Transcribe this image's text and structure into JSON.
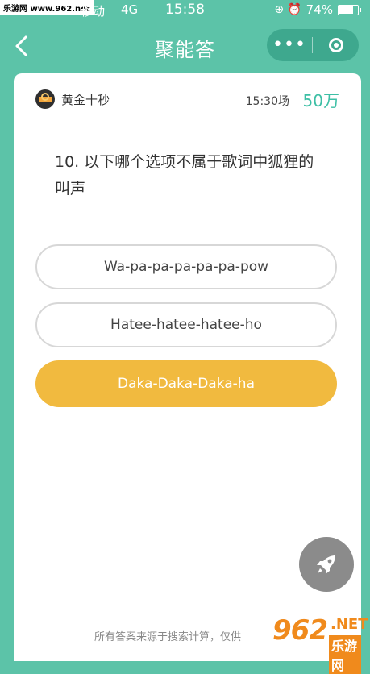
{
  "status_bar": {
    "carrier": "移动",
    "network": "4G",
    "time": "15:58",
    "battery": "74%",
    "watermark": "乐游网 www.962.net"
  },
  "nav": {
    "title": "聚能答",
    "more_label": "•••"
  },
  "card": {
    "show_name": "黄金十秒",
    "session_time": "15:30场",
    "prize": "50万",
    "question": "10. 以下哪个选项不属于歌词中狐狸的叫声",
    "options": [
      {
        "label": "Wa-pa-pa-pa-pa-pa-pow",
        "selected": false
      },
      {
        "label": "Hatee-hatee-hatee-ho",
        "selected": false
      },
      {
        "label": "Daka-Daka-Daka-ha",
        "selected": true
      }
    ],
    "disclaimer": "所有答案来源于搜索计算，仅供",
    "watermark_number": "962",
    "watermark_net": ".NET",
    "watermark_site": "乐游网"
  },
  "colors": {
    "background": "#5cc3a8",
    "accent": "#3dbfa5",
    "selected_option": "#f1ba3f"
  },
  "icons": {
    "back": "chevron-left-icon",
    "close": "target-circle-icon",
    "fab": "rocket-icon"
  }
}
